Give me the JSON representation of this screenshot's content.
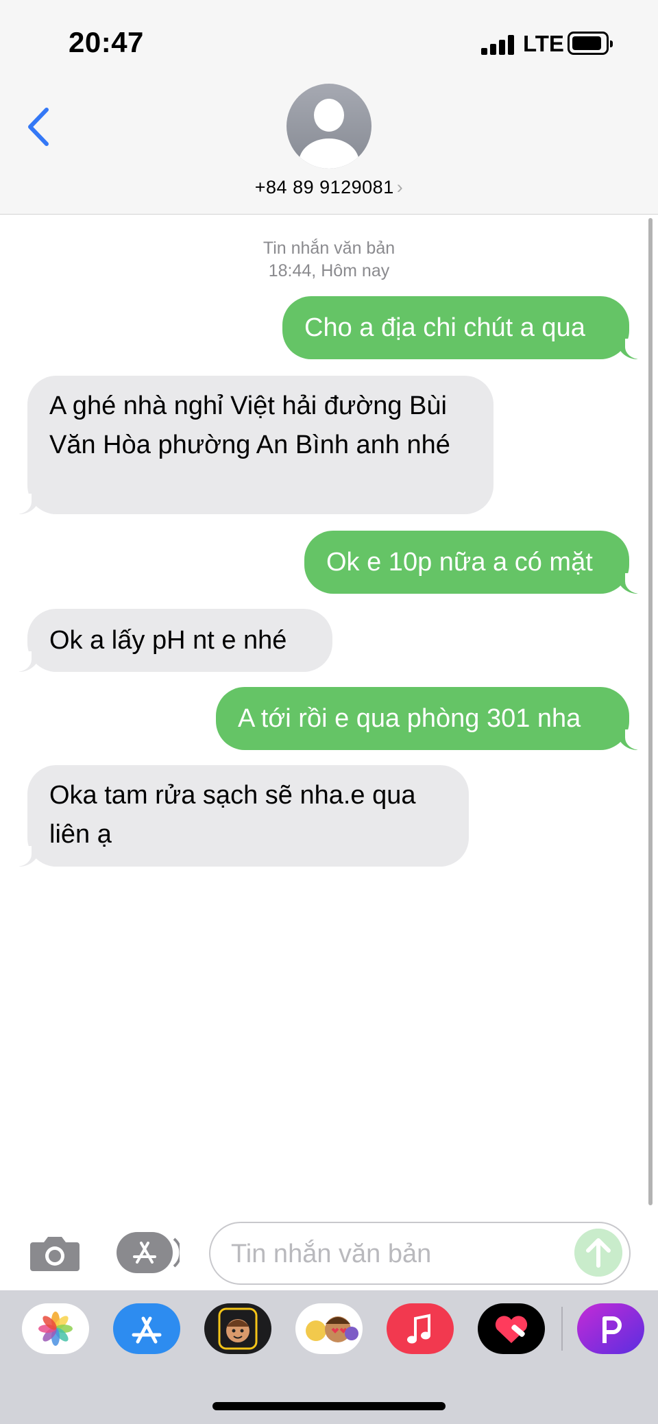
{
  "status_bar": {
    "time": "20:47",
    "network": "LTE"
  },
  "header": {
    "contact": "+84 89 9129081",
    "chevron": "›"
  },
  "thread": {
    "meta_line1": "Tin nhắn văn bản",
    "meta_line2": "18:44, Hôm nay",
    "messages": [
      {
        "from": "me",
        "text": "Cho a địa chi chút a qua"
      },
      {
        "from": "them",
        "text": "A ghé nhà nghỉ Việt hải đường Bùi Văn Hòa phường An Bình anh nhé"
      },
      {
        "from": "me",
        "text": "Ok e 10p nữa a có mặt"
      },
      {
        "from": "them",
        "text": "Ok a lấy pH nt e nhé"
      },
      {
        "from": "me",
        "text": "A tới rồi e qua phòng 301 nha"
      },
      {
        "from": "them",
        "text": "Oka tam rửa sạch sẽ nha.e qua liên ạ"
      }
    ]
  },
  "composer": {
    "placeholder": "Tin nhắn văn bản"
  },
  "dock_apps": [
    "photos-icon",
    "app-store-icon",
    "memoji-icon",
    "animoji-stickers-icon",
    "music-icon",
    "heart-app-icon",
    "picsart-icon"
  ],
  "colors": {
    "sent_bubble": "#65c466",
    "received_bubble": "#e9e9eb",
    "accent_blue": "#3478f6"
  }
}
